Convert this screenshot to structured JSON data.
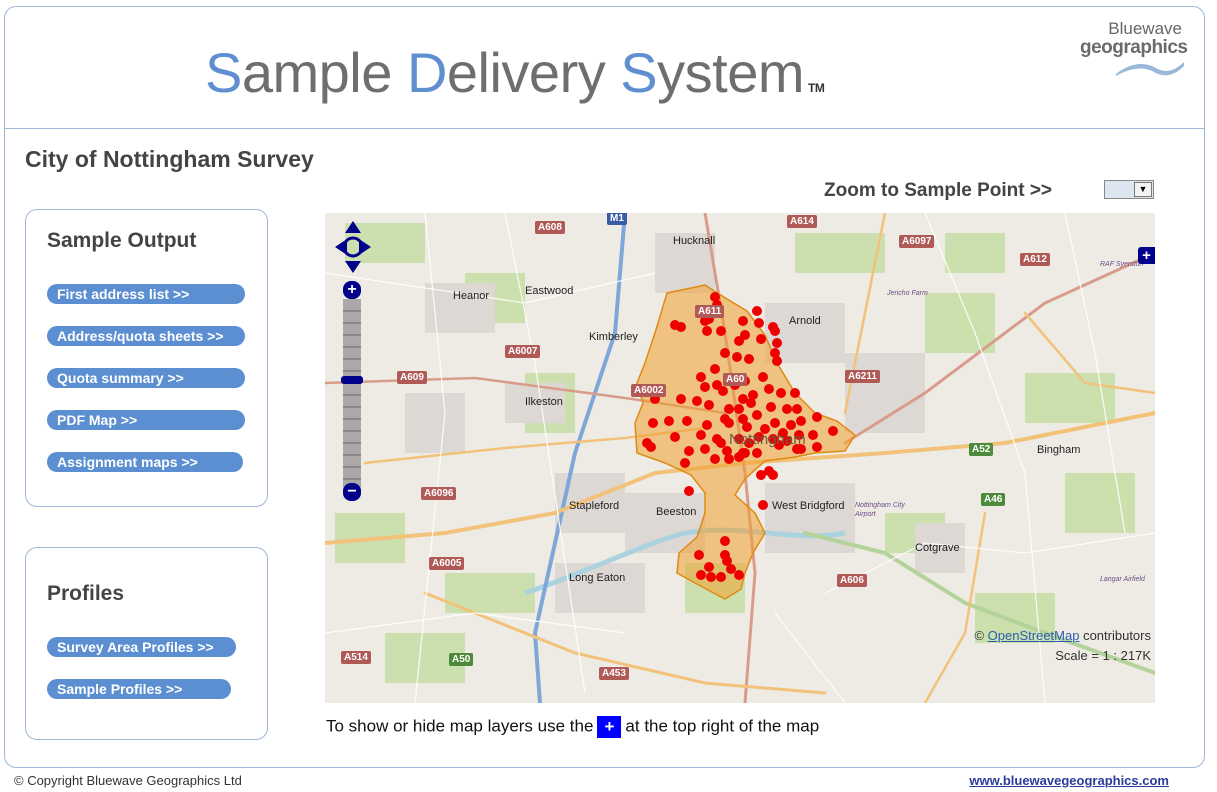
{
  "header": {
    "title_parts": [
      {
        "text": "S",
        "cap": true
      },
      {
        "text": "ample ",
        "cap": false
      },
      {
        "text": "D",
        "cap": true
      },
      {
        "text": "elivery ",
        "cap": false
      },
      {
        "text": "S",
        "cap": true
      },
      {
        "text": "ystem",
        "cap": false
      }
    ],
    "trademark": "TM",
    "logo_line1": "Bluewave",
    "logo_line2": "geographics"
  },
  "survey_title": "City of Nottingham Survey",
  "zoom": {
    "label": "Zoom to Sample Point >>",
    "selected": ""
  },
  "sample_output": {
    "heading": "Sample Output",
    "links": [
      "First address list >>",
      "Address/quota sheets >>",
      "Quota summary >>",
      "PDF Map >>",
      "Assignment maps >>"
    ]
  },
  "profiles": {
    "heading": "Profiles",
    "links": [
      "Survey Area Profiles >>",
      "Sample Profiles >>"
    ]
  },
  "map": {
    "attribution_prefix": "© ",
    "attribution_link": "OpenStreetMap",
    "attribution_suffix": " contributors",
    "scale": "Scale = 1 : 217K",
    "zoom_in": "+",
    "zoom_out": "−",
    "layer_switcher": "+",
    "places": [
      "Hucknall",
      "Eastwood",
      "Heanor",
      "Kimberley",
      "Arnold",
      "Ilkeston",
      "Nottingham",
      "Stapleford",
      "Beeston",
      "West Bridgford",
      "Long Eaton",
      "Bingham",
      "Cotgrave",
      "RAF Syerston",
      "Jericho Farm",
      "Nottingham City Airport",
      "Langar Airfield"
    ],
    "roads": [
      "A608",
      "M1",
      "A611",
      "A614",
      "A6097",
      "A612",
      "A609",
      "A6007",
      "A6002",
      "A6211",
      "A60",
      "A52",
      "A6096",
      "A6005",
      "A453",
      "A50",
      "A514",
      "A606",
      "A46"
    ],
    "colors": {
      "area_fill": "#f0a030",
      "area_stroke": "#e08a10",
      "point": "#ee0000",
      "control": "#00008b"
    }
  },
  "hint": {
    "before": "To show or hide map layers use the",
    "icon": "+",
    "after": "at the top right of the map"
  },
  "footer": {
    "copyright": "© Copyright Bluewave Geographics Ltd",
    "website": "www.bluewavegeographics.com"
  }
}
